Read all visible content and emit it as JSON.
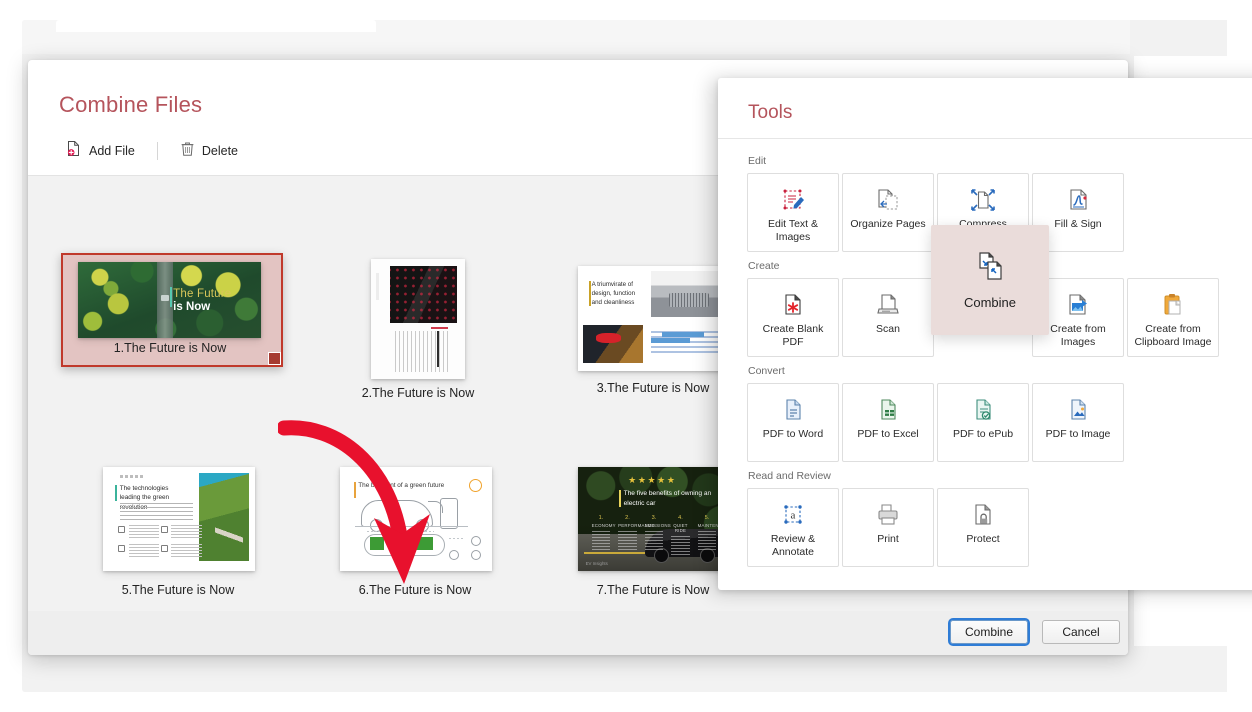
{
  "dialog": {
    "title": "Combine Files",
    "toolbar": {
      "add_file": "Add File",
      "delete": "Delete",
      "add_file_icon": "document-add-icon",
      "delete_icon": "trash-icon"
    },
    "footer": {
      "combine": "Combine",
      "cancel": "Cancel"
    },
    "files": [
      {
        "index": "1",
        "label": "1.The Future is Now",
        "selected": true,
        "slide": {
          "headline_line1": "The Future",
          "headline_line2": "is Now",
          "kind": "forest-aerial-photo"
        }
      },
      {
        "index": "2",
        "label": "2.The Future is Now",
        "selected": false,
        "slide": {
          "headline": "A bold new chapter of motoring engineering",
          "kind": "car-detail-dark"
        }
      },
      {
        "index": "3",
        "label": "3.The Future is Now",
        "selected": false,
        "slide": {
          "headline": "A triumvirate of design, function and cleanliness",
          "kind": "car-front-grille"
        }
      },
      {
        "index": "5",
        "label": "5.The Future is Now",
        "selected": false,
        "slide": {
          "headline": "The technologies leading the green revolution",
          "kind": "green-hill-road"
        }
      },
      {
        "index": "6",
        "label": "6.The Future is Now",
        "selected": false,
        "slide": {
          "headline": "The blueprint of a green future",
          "kind": "ev-charging-diagram"
        }
      },
      {
        "index": "7",
        "label": "7.The Future is Now",
        "selected": false,
        "slide": {
          "headline": "The five benefits of owning an electric car",
          "stars": "★★★★★",
          "columns": [
            "1.",
            "2.",
            "3.",
            "4.",
            "5."
          ],
          "kind": "electric-car-night"
        }
      }
    ]
  },
  "tools": {
    "title": "Tools",
    "sections": [
      {
        "label": "Edit",
        "items": [
          {
            "label": "Edit Text & Images",
            "icon": "edit-text-images-icon"
          },
          {
            "label": "Organize Pages",
            "icon": "organize-pages-icon"
          },
          {
            "label": "Compress",
            "icon": "compress-icon"
          },
          {
            "label": "Fill & Sign",
            "icon": "fill-sign-icon"
          }
        ]
      },
      {
        "label": "Create",
        "items": [
          {
            "label": "Create Blank PDF",
            "icon": "create-blank-pdf-icon"
          },
          {
            "label": "Scan",
            "icon": "scanner-icon"
          },
          {
            "label": "Combine",
            "icon": "combine-icon",
            "highlighted": true
          },
          {
            "label": "Create from Images",
            "icon": "create-from-images-icon"
          },
          {
            "label": "Create from Clipboard Image",
            "icon": "clipboard-icon"
          }
        ]
      },
      {
        "label": "Convert",
        "items": [
          {
            "label": "PDF to Word",
            "icon": "pdf-to-word-icon"
          },
          {
            "label": "PDF to Excel",
            "icon": "pdf-to-excel-icon"
          },
          {
            "label": "PDF to ePub",
            "icon": "pdf-to-epub-icon"
          },
          {
            "label": "PDF to Image",
            "icon": "pdf-to-image-icon"
          }
        ]
      },
      {
        "label": "Read and Review",
        "items": [
          {
            "label": "Review & Annotate",
            "icon": "review-annotate-icon"
          },
          {
            "label": "Print",
            "icon": "printer-icon"
          },
          {
            "label": "Protect",
            "icon": "lock-icon"
          }
        ]
      }
    ]
  },
  "annotation": {
    "arrow": "red-curved-arrow-from-file-1-to-file-6"
  },
  "colors": {
    "brand_red": "#b5545c",
    "accent_red": "#c0392b",
    "selection_fill": "#e3c4c2",
    "highlight_tile": "#eadcda",
    "focus_blue": "#2e7cd6",
    "panel_bg": "#f2f2f2"
  }
}
